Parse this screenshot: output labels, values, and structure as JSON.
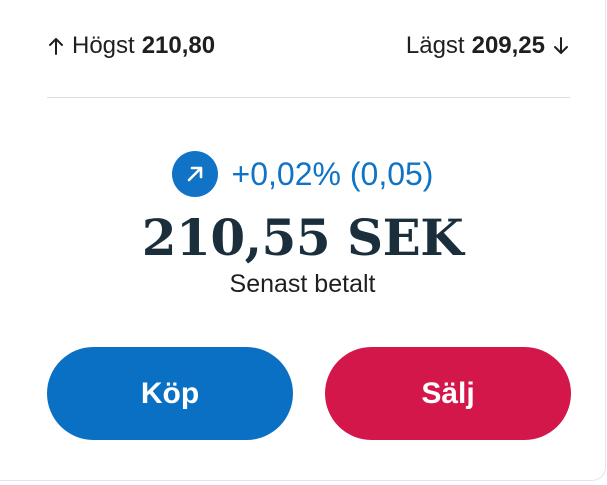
{
  "range": {
    "high_label": "Högst",
    "high_value": "210,80",
    "low_label": "Lägst",
    "low_value": "209,25"
  },
  "change": {
    "text": "+0,02% (0,05)",
    "direction": "up",
    "color": "#1173c6"
  },
  "price": {
    "value": "210,55 SEK",
    "caption": "Senast betalt",
    "color": "#1b2e3c"
  },
  "actions": {
    "buy_label": "Köp",
    "buy_color": "#0a70c4",
    "sell_label": "Sälj",
    "sell_color": "#d3174b"
  },
  "icons": {
    "high": "arrow-up-icon",
    "low": "arrow-down-icon",
    "change": "trend-up-right-icon"
  }
}
